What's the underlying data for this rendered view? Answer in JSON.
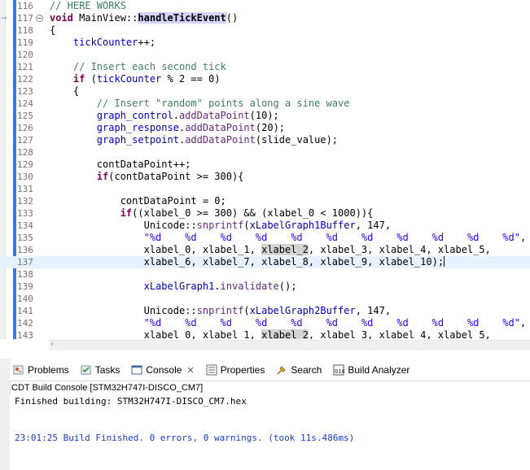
{
  "editor": {
    "lines": [
      {
        "n": "116",
        "html": "<span class='cm'>// HERE WORKS</span>"
      },
      {
        "n": "117",
        "html": "<span class='kw'>void</span> MainView::<span class='fn-dec'>handleTickEvent</span>()",
        "override": true,
        "fold": true
      },
      {
        "n": "118",
        "html": "{"
      },
      {
        "n": "119",
        "html": "    <span class='var'>tickCounter</span>++;"
      },
      {
        "n": "120",
        "html": ""
      },
      {
        "n": "121",
        "html": "    <span class='cm'>// Insert each second tick</span>"
      },
      {
        "n": "122",
        "html": "    <span class='kw'>if</span> (<span class='var'>tickCounter</span> % 2 == 0)"
      },
      {
        "n": "123",
        "html": "    {"
      },
      {
        "n": "124",
        "html": "        <span class='cm'>// Insert \"random\" points along a sine wave</span>"
      },
      {
        "n": "125",
        "html": "        <span class='var'>graph_control</span>.<span class='fn'>addDataPoint</span>(10);"
      },
      {
        "n": "126",
        "html": "        <span class='var'>graph_response</span>.<span class='fn'>addDataPoint</span>(20);"
      },
      {
        "n": "127",
        "html": "        <span class='var'>graph_setpoint</span>.<span class='fn'>addDataPoint</span>(slide_value);"
      },
      {
        "n": "128",
        "html": ""
      },
      {
        "n": "129",
        "html": "        contDataPoint++;"
      },
      {
        "n": "130",
        "html": "        <span class='kw'>if</span>(contDataPoint &gt;= 300){"
      },
      {
        "n": "131",
        "html": ""
      },
      {
        "n": "132",
        "html": "            contDataPoint = 0;"
      },
      {
        "n": "133",
        "html": "            <span class='kw'>if</span>((xlabel_0 &gt;= 300) &amp;&amp; (xlabel_0 &lt; 1000)){"
      },
      {
        "n": "134",
        "html": "                Unicode::<span class='fn'>snprintf</span>(<span class='var'>xLabelGraph1Buffer</span>, 147,"
      },
      {
        "n": "135",
        "html": "                <span class='str'>\"%d    %d    %d    %d    %d    %d    %d    %d    %d    %d    %d\"</span>,"
      },
      {
        "n": "136",
        "html": "                xlabel_0, xlabel_1, <span class='hl'>xlabel_2</span>, xlabel_3, xlabel_4, xlabel_5,"
      },
      {
        "n": "137",
        "html": "                xlabel_6, xlabel_7, xlabel_8, xlabel_9, xlabel_10);<span class='caret'></span>",
        "current": true
      },
      {
        "n": "138",
        "html": ""
      },
      {
        "n": "139",
        "html": "                <span class='var'>xLabelGraph1</span>.<span class='fn'>invalidate</span>();"
      },
      {
        "n": "140",
        "html": ""
      },
      {
        "n": "141",
        "html": "                Unicode::<span class='fn'>snprintf</span>(<span class='var'>xLabelGraph2Buffer</span>, 147,"
      },
      {
        "n": "142",
        "html": "                <span class='str'>\"%d    %d    %d    %d    %d    %d    %d    %d    %d    %d    %d\"</span>,"
      },
      {
        "n": "143",
        "html": "                xlabel_0, xlabel_1, <span class='hl'>xlabel_2</span>, xlabel_3, xlabel_4, xlabel_5,"
      }
    ]
  },
  "tabs": [
    {
      "label": "Problems",
      "icon": "problems-icon"
    },
    {
      "label": "Tasks",
      "icon": "tasks-icon"
    },
    {
      "label": "Console",
      "icon": "console-icon",
      "active": true,
      "closable": true
    },
    {
      "label": "Properties",
      "icon": "properties-icon"
    },
    {
      "label": "Search",
      "icon": "search-icon"
    },
    {
      "label": "Build Analyzer",
      "icon": "build-analyzer-icon"
    }
  ],
  "console": {
    "title": "CDT Build Console [STM32H747I-DISCO_CM7]",
    "line1": "Finished building: STM32H747I-DISCO_CM7.hex",
    "line2": "23:01:25 Build Finished. 0 errors, 0 warnings. (took 11s.486ms)"
  },
  "colors": {
    "keyword": "#7f0055",
    "comment": "#3f7f5f",
    "string": "#2a00ff",
    "field": "#0000c0",
    "build_finished": "#1a3ccc"
  }
}
